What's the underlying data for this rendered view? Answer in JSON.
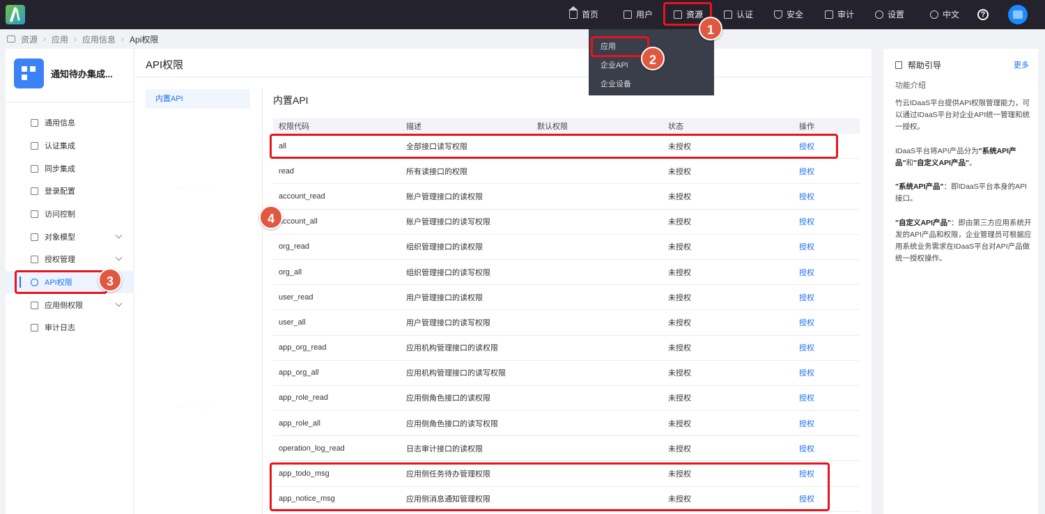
{
  "topnav": {
    "items": [
      {
        "label": "首页",
        "icon": "home-icon"
      },
      {
        "label": "用户",
        "icon": "user-icon"
      },
      {
        "label": "资源",
        "icon": "folder-icon"
      },
      {
        "label": "认证",
        "icon": "monitor-icon"
      },
      {
        "label": "安全",
        "icon": "shield-icon"
      },
      {
        "label": "审计",
        "icon": "audit-icon"
      },
      {
        "label": "设置",
        "icon": "gear-icon"
      },
      {
        "label": "中文",
        "icon": "globe-icon"
      }
    ],
    "help_symbol": "?"
  },
  "dropdown": {
    "items": [
      "应用",
      "企业API",
      "企业设备"
    ]
  },
  "breadcrumb": {
    "items": [
      "资源",
      "应用",
      "应用信息"
    ],
    "current": "Api权限"
  },
  "app": {
    "name": "通知待办集成..."
  },
  "sidebar": {
    "items": [
      {
        "label": "通用信息"
      },
      {
        "label": "认证集成"
      },
      {
        "label": "同步集成"
      },
      {
        "label": "登录配置"
      },
      {
        "label": "访问控制"
      },
      {
        "label": "对象模型"
      },
      {
        "label": "授权管理"
      },
      {
        "label": "API权限"
      },
      {
        "label": "应用侧权限"
      },
      {
        "label": "审计日志"
      }
    ]
  },
  "main": {
    "title": "API权限",
    "subtab": "内置API",
    "section_title": "内置API",
    "columns": [
      "权限代码",
      "描述",
      "默认权限",
      "状态",
      "操作"
    ],
    "rows": [
      {
        "code": "all",
        "desc": "全部接口读写权限",
        "default": "",
        "status": "未授权",
        "action": "授权"
      },
      {
        "code": "read",
        "desc": "所有读接口的权限",
        "default": "",
        "status": "未授权",
        "action": "授权"
      },
      {
        "code": "account_read",
        "desc": "账户管理接口的读权限",
        "default": "",
        "status": "未授权",
        "action": "授权"
      },
      {
        "code": "account_all",
        "desc": "账户管理接口的读写权限",
        "default": "",
        "status": "未授权",
        "action": "授权"
      },
      {
        "code": "org_read",
        "desc": "组织管理接口的读权限",
        "default": "",
        "status": "未授权",
        "action": "授权"
      },
      {
        "code": "org_all",
        "desc": "组织管理接口的读写权限",
        "default": "",
        "status": "未授权",
        "action": "授权"
      },
      {
        "code": "user_read",
        "desc": "用户管理接口的读权限",
        "default": "",
        "status": "未授权",
        "action": "授权"
      },
      {
        "code": "user_all",
        "desc": "用户管理接口的读写权限",
        "default": "",
        "status": "未授权",
        "action": "授权"
      },
      {
        "code": "app_org_read",
        "desc": "应用机构管理接口的读权限",
        "default": "",
        "status": "未授权",
        "action": "授权"
      },
      {
        "code": "app_org_all",
        "desc": "应用机构管理接口的读写权限",
        "default": "",
        "status": "未授权",
        "action": "授权"
      },
      {
        "code": "app_role_read",
        "desc": "应用侧角色接口的读权限",
        "default": "",
        "status": "未授权",
        "action": "授权"
      },
      {
        "code": "app_role_all",
        "desc": "应用侧角色接口的读写权限",
        "default": "",
        "status": "未授权",
        "action": "授权"
      },
      {
        "code": "operation_log_read",
        "desc": "日志审计接口的读权限",
        "default": "",
        "status": "未授权",
        "action": "授权"
      },
      {
        "code": "app_todo_msg",
        "desc": "应用侧任务待办管理权限",
        "default": "",
        "status": "未授权",
        "action": "授权"
      },
      {
        "code": "app_notice_msg",
        "desc": "应用侧消息通知管理权限",
        "default": "",
        "status": "未授权",
        "action": "授权"
      }
    ]
  },
  "help": {
    "title": "帮助引导",
    "more": "更多",
    "subtitle": "功能介绍",
    "p1": "竹云IDaaS平台提供API权限管理能力，可以通过IDaaS平台对企业API统一管理和统一授权。",
    "p2_a": "IDaaS平台将API产品分为",
    "p2_b": "\"系统API产品\"",
    "p2_c": "和",
    "p2_d": "\"自定义API产品\"",
    "p2_e": "。",
    "p3_a": "\"系统API产品\"",
    "p3_b": "：即IDaaS平台本身的API接口。",
    "p4_a": "\"自定义API产品\"",
    "p4_b": "：即由第三方应用系统开发的API产品和权限，企业管理员可根据应用系统业务需求在IDaaS平台对API产品做统一授权操作。"
  },
  "annotations": [
    "1",
    "2",
    "3",
    "4"
  ],
  "colors": {
    "topbar": "#24232d",
    "accent": "#1a6ff5",
    "annotation_red": "#e8141c",
    "badge": "#e0583f"
  }
}
